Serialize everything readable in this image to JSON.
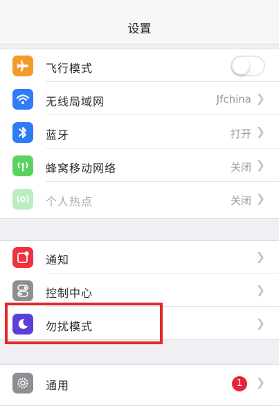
{
  "nav": {
    "title": "设置"
  },
  "group1": [
    {
      "label": "飞行模式",
      "icon": "airplane-icon",
      "icon_color": "#f39a2b",
      "type": "toggle",
      "toggle_on": false
    },
    {
      "label": "无线局域网",
      "icon": "wifi-icon",
      "icon_color": "#2f7cf6",
      "value": "Jfchina",
      "type": "chevron"
    },
    {
      "label": "蓝牙",
      "icon": "bluetooth-icon",
      "icon_color": "#2f7cf6",
      "value": "打开",
      "type": "chevron"
    },
    {
      "label": "蜂窝移动网络",
      "icon": "cellular-icon",
      "icon_color": "#5ad35e",
      "value": "关闭",
      "type": "chevron"
    },
    {
      "label": "个人热点",
      "icon": "hotspot-icon",
      "icon_color": "#5ad35e",
      "value": "关闭",
      "type": "chevron",
      "disabled": true
    }
  ],
  "group2": [
    {
      "label": "通知",
      "icon": "notifications-icon",
      "icon_color": "#f0313e"
    },
    {
      "label": "控制中心",
      "icon": "control-center-icon",
      "icon_color": "#8e8e93"
    },
    {
      "label": "勿扰模式",
      "icon": "moon-icon",
      "icon_color": "#5b3fd6"
    }
  ],
  "group3": [
    {
      "label": "通用",
      "icon": "gear-icon",
      "icon_color": "#8e8e93",
      "badge": "1"
    }
  ],
  "colors": {
    "highlight": "#e5282c"
  }
}
